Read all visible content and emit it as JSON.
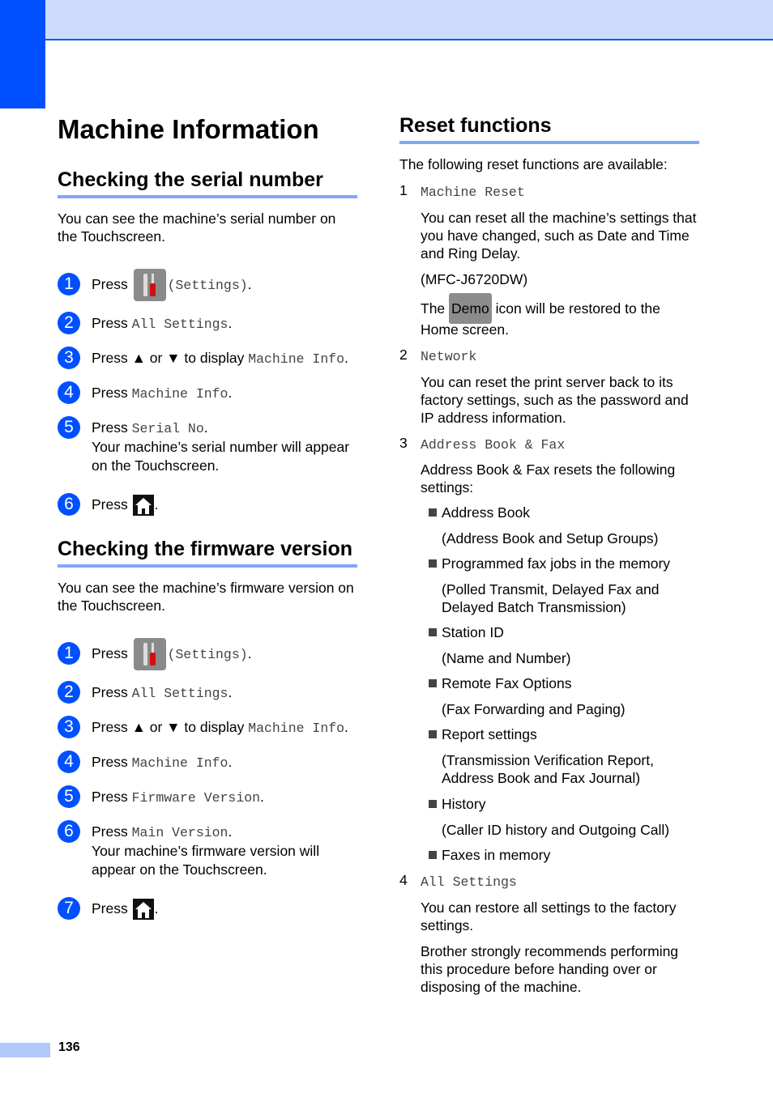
{
  "page": {
    "number": "136",
    "title": "Machine Information"
  },
  "serial": {
    "heading": "Checking the serial number",
    "intro": "You can see the machine’s serial number on the Touchscreen.",
    "steps": [
      {
        "n": "1",
        "prefix": "Press",
        "code": "(Settings)",
        "suffix": "."
      },
      {
        "n": "2",
        "prefix": "Press",
        "code": "All Settings",
        "suffix": "."
      },
      {
        "n": "3",
        "prefix": "Press ▲ or ▼ to display",
        "code": "Machine Info",
        "suffix": "."
      },
      {
        "n": "4",
        "prefix": "Press",
        "code": "Machine Info",
        "suffix": "."
      },
      {
        "n": "5",
        "prefix": "Press",
        "code": "Serial No",
        "suffix": ".",
        "note": "Your machine’s serial number will appear on the Touchscreen."
      },
      {
        "n": "6",
        "prefix": "Press",
        "suffix": "."
      }
    ]
  },
  "firmware": {
    "heading": "Checking the firmware version",
    "intro": "You can see the machine’s firmware version on the Touchscreen.",
    "steps": [
      {
        "n": "1",
        "prefix": "Press",
        "code": "(Settings)",
        "suffix": "."
      },
      {
        "n": "2",
        "prefix": "Press",
        "code": "All Settings",
        "suffix": "."
      },
      {
        "n": "3",
        "prefix": "Press ▲ or ▼ to display",
        "code": "Machine Info",
        "suffix": "."
      },
      {
        "n": "4",
        "prefix": "Press",
        "code": "Machine Info",
        "suffix": "."
      },
      {
        "n": "5",
        "prefix": "Press",
        "code": "Firmware Version",
        "suffix": "."
      },
      {
        "n": "6",
        "prefix": "Press",
        "code": "Main Version",
        "suffix": ".",
        "note": "Your machine’s firmware version will appear on the Touchscreen."
      },
      {
        "n": "7",
        "prefix": "Press",
        "suffix": "."
      }
    ]
  },
  "reset": {
    "heading": "Reset functions",
    "intro": "The following reset functions are available:",
    "item1": {
      "n": "1",
      "code": "Machine Reset",
      "desc": "You can reset all the machine’s settings that you have changed, such as Date and Time and Ring Delay.",
      "model": "(MFC-J6720DW)",
      "demo_pre": "The",
      "demo_label": "Demo",
      "demo_post": "icon will be restored to the",
      "demo_line2": "Home screen."
    },
    "item2": {
      "n": "2",
      "code": "Network",
      "desc": "You can reset the print server back to its factory settings, such as the password and IP address information."
    },
    "item3": {
      "n": "3",
      "code": "Address Book & Fax",
      "desc": "Address Book & Fax resets the following settings:",
      "bullets": [
        {
          "label": "Address Book",
          "detail": "(Address Book and Setup Groups)"
        },
        {
          "label": "Programmed fax jobs in the memory",
          "detail": "(Polled Transmit, Delayed Fax and Delayed Batch Transmission)"
        },
        {
          "label": "Station ID",
          "detail": "(Name and Number)"
        },
        {
          "label": "Remote Fax Options",
          "detail": "(Fax Forwarding and Paging)"
        },
        {
          "label": "Report settings",
          "detail": "(Transmission Verification Report, Address Book and Fax Journal)"
        },
        {
          "label": "History",
          "detail": "(Caller ID history and Outgoing Call)"
        },
        {
          "label": "Faxes in memory"
        }
      ]
    },
    "item4": {
      "n": "4",
      "code": "All Settings",
      "desc": "You can restore all settings to the factory settings.",
      "note": "Brother strongly recommends performing this procedure before handing over or disposing of the machine."
    }
  }
}
